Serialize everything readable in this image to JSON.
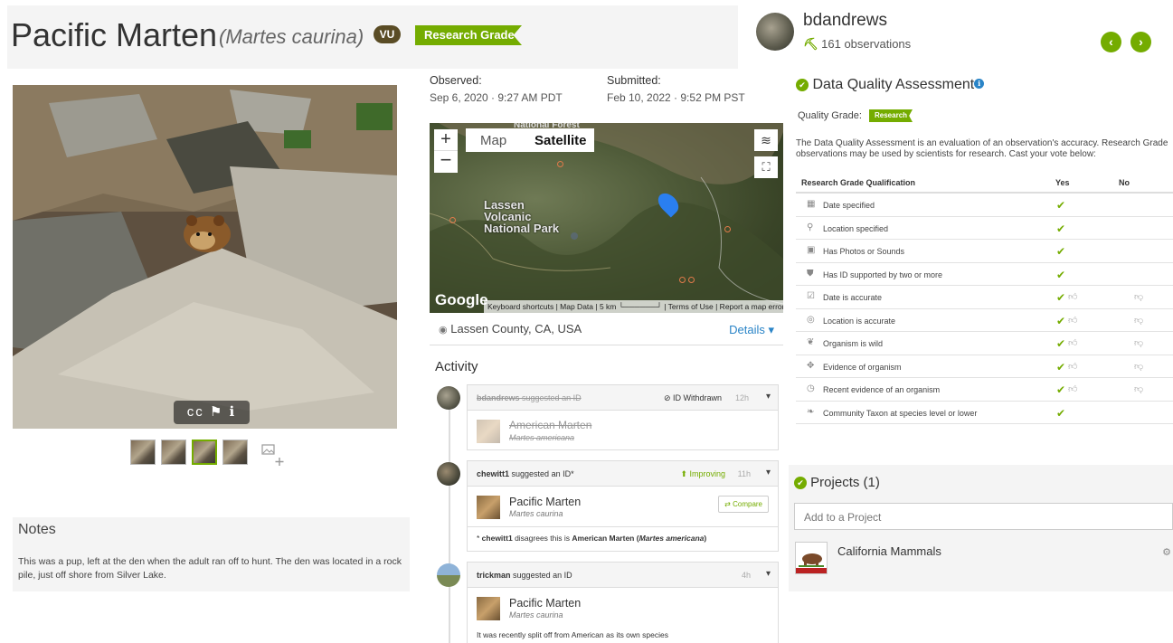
{
  "title": {
    "common_name": "Pacific Marten",
    "scientific_name": "(Martes caurina)",
    "status_badge": "VU",
    "quality_flag": "Research Grade"
  },
  "photo": {
    "overlay_icons": "cc ⚑ ℹ",
    "thumb_count": 4
  },
  "notes": {
    "heading": "Notes",
    "text": "This was a pup, left at the den when the adult ran off to hunt. The den was located in a rock pile, just off shore from Silver Lake."
  },
  "meta": {
    "observed_label": "Observed:",
    "observed_value": "Sep 6, 2020 · 9:27 AM PDT",
    "submitted_label": "Submitted:",
    "submitted_value": "Feb 10, 2022 · 9:52 PM PST"
  },
  "map": {
    "zoom_in": "+",
    "zoom_out": "−",
    "type_map": "Map",
    "type_satellite": "Satellite",
    "park_label": "Lassen\nVolcanic\nNational Park",
    "top_label": "National Forest",
    "google": "Google",
    "footer": "Keyboard shortcuts | Map Data | 5 km └──────┘ | Terms of Use | Report a map error",
    "location": "Lassen County, CA, USA",
    "details": "Details ▾"
  },
  "activity": {
    "heading": "Activity",
    "items": [
      {
        "user": "bdandrews",
        "action": "suggested an ID",
        "status": "⊘ ID Withdrawn",
        "time": "12h",
        "taxon_common": "American Marten",
        "taxon_sci": "Martes americana"
      },
      {
        "user": "chewitt1",
        "action": "suggested an ID*",
        "status": "⬆ Improving",
        "time": "11h",
        "taxon_common": "Pacific Marten",
        "taxon_sci": "Martes caurina",
        "compare": "⇄ Compare",
        "note_user": "chewitt1",
        "note_text": "disagrees this is",
        "note_taxon": "American Marten",
        "note_sci": "Martes americana"
      },
      {
        "user": "trickman",
        "action": "suggested an ID",
        "time": "4h",
        "taxon_common": "Pacific Marten",
        "taxon_sci": "Martes caurina",
        "comment": "It was recently split off from American as its own species"
      }
    ]
  },
  "user": {
    "name": "bdandrews",
    "observations": "161 observations",
    "prev": "‹",
    "next": "›"
  },
  "dqa": {
    "title": "Data Quality Assessment",
    "info_icon": "ℹ",
    "quality_label": "Quality Grade:",
    "quality_value": "Research",
    "description": "The Data Quality Assessment is an evaluation of an observation's accuracy. Research Grade observations may be used by scientists for research. Cast your vote below:",
    "col_criterion": "Research Grade Qualification",
    "col_yes": "Yes",
    "col_no": "No",
    "rows": [
      {
        "icon": "calendar-icon",
        "glyph": "▦",
        "label": "Date specified",
        "votable": false
      },
      {
        "icon": "map-marker-icon",
        "glyph": "⚲",
        "label": "Location specified",
        "votable": false
      },
      {
        "icon": "image-icon",
        "glyph": "▣",
        "label": "Has Photos or Sounds",
        "votable": false
      },
      {
        "icon": "id-badge-icon",
        "glyph": "⛊",
        "label": "Has ID supported by two or more",
        "votable": false
      },
      {
        "icon": "calendar-check-icon",
        "glyph": "☑",
        "label": "Date is accurate",
        "votable": true
      },
      {
        "icon": "bullseye-icon",
        "glyph": "◎",
        "label": "Location is accurate",
        "votable": true
      },
      {
        "icon": "leaf-wild-icon",
        "glyph": "❦",
        "label": "Organism is wild",
        "votable": true
      },
      {
        "icon": "footprint-icon",
        "glyph": "✥",
        "label": "Evidence of organism",
        "votable": true
      },
      {
        "icon": "clock-icon",
        "glyph": "◷",
        "label": "Recent evidence of an organism",
        "votable": true
      },
      {
        "icon": "leaf-icon",
        "glyph": "❧",
        "label": "Community Taxon at species level or lower",
        "votable": false
      }
    ],
    "check": "✔",
    "thumb_up": "👍︎",
    "thumb_down": "👎︎"
  },
  "projects": {
    "title": "Projects (1)",
    "input_placeholder": "Add to a Project",
    "project_name": "California Mammals",
    "gear": "⚙"
  },
  "colors": {
    "brand_green": "#74ac00",
    "vu_brown": "#5a4c25",
    "link_blue": "#2a84c7"
  }
}
